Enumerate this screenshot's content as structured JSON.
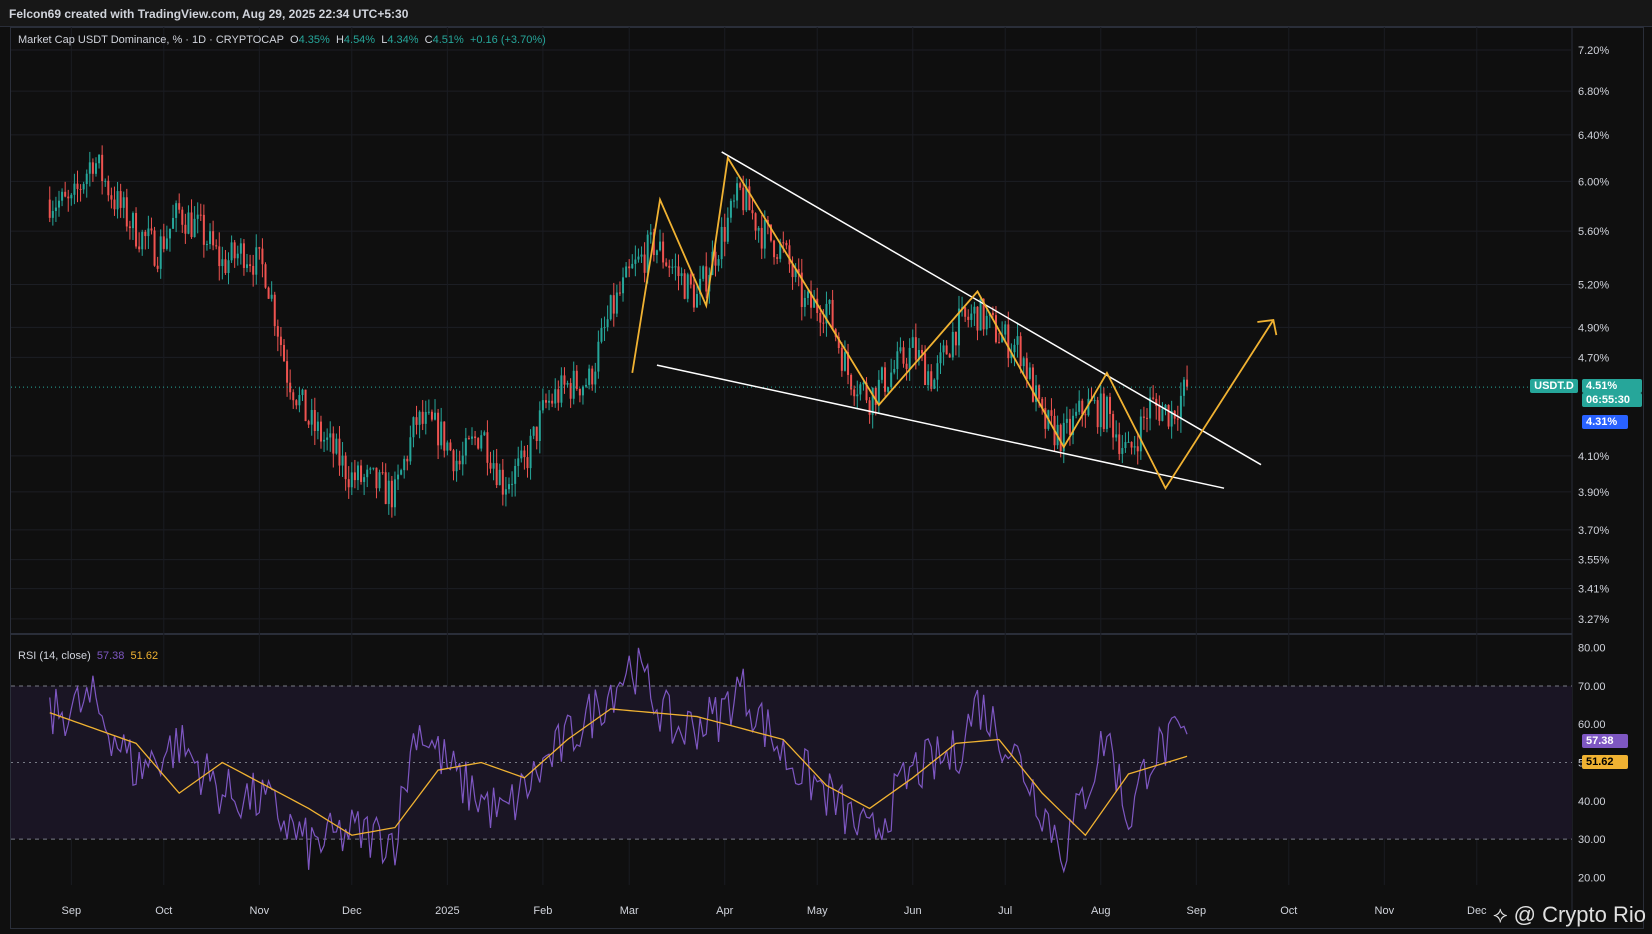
{
  "header": {
    "attribution": "Felcon69 created with TradingView.com, Aug 29, 2025 22:34 UTC+5:30"
  },
  "legend": {
    "symbol": "Market Cap USDT Dominance, % · 1D · CRYPTOCAP",
    "o_label": "O",
    "o_value": "4.35%",
    "h_label": "H",
    "h_value": "4.54%",
    "l_label": "L",
    "l_value": "4.34%",
    "c_label": "C",
    "c_value": "4.51%",
    "change": "+0.16 (+3.70%)"
  },
  "rsi_legend": {
    "title": "RSI (14, close)",
    "rsi_value": "57.38",
    "ma_value": "51.62"
  },
  "price_tags": {
    "symbol": "USDT.D",
    "last": "4.51%",
    "countdown": "06:55:30",
    "marker": "4.31%"
  },
  "rsi_tags": {
    "rsi": "57.38",
    "ma": "51.62"
  },
  "watermark": "@ Crypto Rio",
  "colors": {
    "up": "#26a69a",
    "down": "#ef5350",
    "trendline": "#ffffff",
    "pattern": "#f0b232",
    "rsi": "#7e57c2",
    "rsi_ma": "#f0b232"
  },
  "chart_data": [
    {
      "type": "candlestick",
      "title": "Market Cap USDT Dominance, % · 1D · CRYPTOCAP",
      "x_ticks": [
        "Sep",
        "Oct",
        "Nov",
        "Dec",
        "2025",
        "Feb",
        "Mar",
        "Apr",
        "May",
        "Jun",
        "Jul",
        "Aug",
        "Sep",
        "Oct",
        "Nov",
        "Dec"
      ],
      "y_scale": "log",
      "y_ticks": [
        "7.20%",
        "6.80%",
        "6.40%",
        "6.00%",
        "5.60%",
        "5.20%",
        "4.90%",
        "4.70%",
        "4.10%",
        "3.90%",
        "3.70%",
        "3.55%",
        "3.41%",
        "3.27%"
      ],
      "ylim": [
        3.22,
        7.3
      ],
      "last_close": 4.51,
      "series": [
        {
          "name": "USDT.D close (approx.)",
          "points": [
            [
              "2024-08-25",
              5.85
            ],
            [
              "2024-09-01",
              5.8
            ],
            [
              "2024-09-08",
              6.2
            ],
            [
              "2024-09-15",
              5.85
            ],
            [
              "2024-09-22",
              5.6
            ],
            [
              "2024-09-29",
              5.45
            ],
            [
              "2024-10-06",
              5.75
            ],
            [
              "2024-10-13",
              5.6
            ],
            [
              "2024-10-20",
              5.35
            ],
            [
              "2024-10-27",
              5.45
            ],
            [
              "2024-11-03",
              5.3
            ],
            [
              "2024-11-10",
              4.6
            ],
            [
              "2024-11-17",
              4.3
            ],
            [
              "2024-11-24",
              4.15
            ],
            [
              "2024-12-01",
              3.98
            ],
            [
              "2024-12-08",
              3.95
            ],
            [
              "2024-12-15",
              3.88
            ],
            [
              "2024-12-22",
              4.3
            ],
            [
              "2024-12-29",
              4.25
            ],
            [
              "2025-01-05",
              4.05
            ],
            [
              "2025-01-12",
              4.25
            ],
            [
              "2025-01-19",
              3.95
            ],
            [
              "2025-01-26",
              4.05
            ],
            [
              "2025-02-02",
              4.4
            ],
            [
              "2025-02-09",
              4.52
            ],
            [
              "2025-02-16",
              4.55
            ],
            [
              "2025-02-23",
              5.0
            ],
            [
              "2025-03-02",
              5.3
            ],
            [
              "2025-03-09",
              5.5
            ],
            [
              "2025-03-16",
              5.3
            ],
            [
              "2025-03-23",
              5.1
            ],
            [
              "2025-03-30",
              5.5
            ],
            [
              "2025-04-06",
              5.9
            ],
            [
              "2025-04-13",
              5.6
            ],
            [
              "2025-04-20",
              5.45
            ],
            [
              "2025-04-27",
              5.05
            ],
            [
              "2025-05-04",
              5.05
            ],
            [
              "2025-05-11",
              4.6
            ],
            [
              "2025-05-18",
              4.45
            ],
            [
              "2025-05-25",
              4.6
            ],
            [
              "2025-06-01",
              4.75
            ],
            [
              "2025-06-08",
              4.55
            ],
            [
              "2025-06-15",
              4.9
            ],
            [
              "2025-06-22",
              5.0
            ],
            [
              "2025-06-29",
              4.85
            ],
            [
              "2025-07-06",
              4.75
            ],
            [
              "2025-07-13",
              4.3
            ],
            [
              "2025-07-20",
              4.2
            ],
            [
              "2025-07-27",
              4.4
            ],
            [
              "2025-08-03",
              4.35
            ],
            [
              "2025-08-10",
              4.1
            ],
            [
              "2025-08-17",
              4.4
            ],
            [
              "2025-08-24",
              4.35
            ],
            [
              "2025-08-29",
              4.51
            ]
          ]
        }
      ],
      "annotations": {
        "upper_trendline": [
          [
            "2025-03-31",
            6.25
          ],
          [
            "2025-09-22",
            4.05
          ]
        ],
        "lower_trendline": [
          [
            "2025-03-10",
            4.65
          ],
          [
            "2025-09-10",
            3.92
          ]
        ],
        "zigzag": [
          [
            "2025-03-02",
            4.6
          ],
          [
            "2025-03-11",
            5.85
          ],
          [
            "2025-03-26",
            5.05
          ],
          [
            "2025-04-02",
            6.2
          ],
          [
            "2025-05-21",
            4.4
          ],
          [
            "2025-06-22",
            5.15
          ],
          [
            "2025-07-20",
            4.15
          ],
          [
            "2025-08-03",
            4.6
          ],
          [
            "2025-08-22",
            3.92
          ],
          [
            "2025-09-26",
            4.95
          ]
        ]
      }
    },
    {
      "type": "line",
      "title": "RSI (14, close)",
      "y_ticks": [
        "80.00",
        "70.00",
        "60.00",
        "50.00",
        "40.00",
        "30.00",
        "20.00"
      ],
      "ylim": [
        18,
        82
      ],
      "bands": [
        30,
        70
      ],
      "series": [
        {
          "name": "RSI",
          "last": 57.38,
          "points": [
            [
              "2024-08-25",
              62
            ],
            [
              "2024-09-08",
              66
            ],
            [
              "2024-09-22",
              48
            ],
            [
              "2024-10-06",
              55
            ],
            [
              "2024-10-20",
              42
            ],
            [
              "2024-11-03",
              40
            ],
            [
              "2024-11-17",
              28
            ],
            [
              "2024-12-01",
              32
            ],
            [
              "2024-12-15",
              30
            ],
            [
              "2024-12-22",
              60
            ],
            [
              "2025-01-05",
              45
            ],
            [
              "2025-01-19",
              36
            ],
            [
              "2025-02-02",
              50
            ],
            [
              "2025-02-16",
              62
            ],
            [
              "2025-03-02",
              76
            ],
            [
              "2025-03-16",
              58
            ],
            [
              "2025-03-30",
              62
            ],
            [
              "2025-04-06",
              70
            ],
            [
              "2025-04-20",
              52
            ],
            [
              "2025-05-04",
              42
            ],
            [
              "2025-05-18",
              30
            ],
            [
              "2025-06-01",
              48
            ],
            [
              "2025-06-15",
              52
            ],
            [
              "2025-06-22",
              66
            ],
            [
              "2025-07-06",
              50
            ],
            [
              "2025-07-20",
              27
            ],
            [
              "2025-08-03",
              58
            ],
            [
              "2025-08-10",
              35
            ],
            [
              "2025-08-17",
              52
            ],
            [
              "2025-08-29",
              57.38
            ]
          ]
        },
        {
          "name": "MA",
          "last": 51.62,
          "points": [
            [
              "2024-08-25",
              63
            ],
            [
              "2024-09-08",
              59
            ],
            [
              "2024-09-22",
              55
            ],
            [
              "2024-10-06",
              42
            ],
            [
              "2024-10-20",
              50
            ],
            [
              "2024-11-03",
              44
            ],
            [
              "2024-11-17",
              38
            ],
            [
              "2024-12-01",
              31
            ],
            [
              "2024-12-15",
              33
            ],
            [
              "2024-12-29",
              48
            ],
            [
              "2025-01-12",
              50
            ],
            [
              "2025-01-26",
              46
            ],
            [
              "2025-02-09",
              56
            ],
            [
              "2025-02-23",
              64
            ],
            [
              "2025-03-09",
              63
            ],
            [
              "2025-03-23",
              62
            ],
            [
              "2025-04-06",
              59
            ],
            [
              "2025-04-20",
              56
            ],
            [
              "2025-05-04",
              44
            ],
            [
              "2025-05-18",
              38
            ],
            [
              "2025-06-01",
              46
            ],
            [
              "2025-06-15",
              55
            ],
            [
              "2025-06-29",
              56
            ],
            [
              "2025-07-13",
              42
            ],
            [
              "2025-07-27",
              31
            ],
            [
              "2025-08-10",
              47
            ],
            [
              "2025-08-29",
              51.62
            ]
          ]
        }
      ]
    }
  ]
}
